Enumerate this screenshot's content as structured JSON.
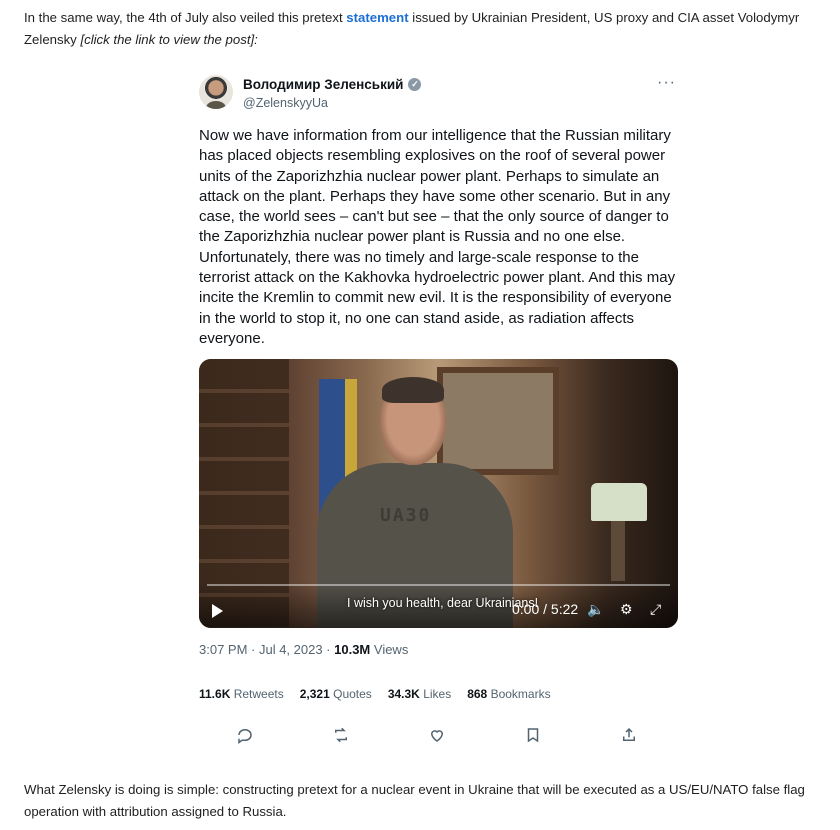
{
  "article": {
    "intro_text": "In the same way, the 4th of July also veiled this pretext ",
    "intro_link": "statement",
    "intro_rest": " issued by Ukrainian President, US proxy and CIA asset Volodymyr Zelensky ",
    "intro_note": "[click the link to view the post]:",
    "outro": "What Zelensky is doing is simple: constructing pretext for a nuclear event in Ukraine that will be executed as a US/EU/NATO false flag operation with attribution assigned to Russia."
  },
  "tweet": {
    "author_name": "Володимир Зеленський",
    "handle": "@ZelenskyyUa",
    "more": "···",
    "text": "Now we have information from our intelligence that the Russian military has placed objects resembling explosives on the roof of several power units of the Zaporizhzhia nuclear power plant. Perhaps to simulate an attack on the plant. Perhaps they have some other scenario. But in any case, the world sees – can't but see – that the only source of danger to the Zaporizhzhia nuclear power plant is Russia and no one else. Unfortunately, there was no timely and large-scale response to the terrorist attack on the Kakhovka hydroelectric power plant. And this may incite the Kremlin to commit new evil. It is the responsibility of everyone in the world to stop it, no one can stand aside, as radiation affects everyone.",
    "video": {
      "caption": "I wish you health, dear Ukrainians!",
      "time": "0:00 / 5:22",
      "shirt_text": "UA30"
    },
    "timestamp": "3:07 PM · Jul 4, 2023 · ",
    "views_count": "10.3M",
    "views_label": " Views",
    "stats": [
      {
        "count": "11.6K",
        "label": "Retweets"
      },
      {
        "count": "2,321",
        "label": "Quotes"
      },
      {
        "count": "34.3K",
        "label": "Likes"
      },
      {
        "count": "868",
        "label": "Bookmarks"
      }
    ],
    "actions": [
      "reply-icon",
      "retweet-icon",
      "like-icon",
      "bookmark-icon",
      "share-icon"
    ]
  }
}
